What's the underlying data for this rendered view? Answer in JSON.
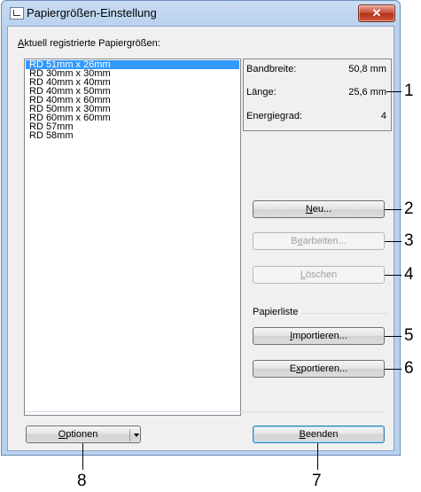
{
  "window": {
    "title": "Papiergrößen-Einstellung",
    "close_symbol": "✕"
  },
  "list": {
    "label_underlined": "A",
    "label_rest": "ktuell registrierte Papiergrößen:",
    "items": [
      "RD 51mm x 26mm",
      "RD 30mm x 30mm",
      "RD 40mm x 40mm",
      "RD 40mm x 50mm",
      "RD 40mm x 60mm",
      "RD 50mm x 30mm",
      "RD 60mm x 60mm",
      "RD 57mm",
      "RD 58mm"
    ],
    "selected_index": 0
  },
  "info": {
    "rows": [
      {
        "label": "Bandbreite:",
        "value": "50,8 mm"
      },
      {
        "label": "Länge:",
        "value": "25,6 mm"
      },
      {
        "label": "Energiegrad:",
        "value": "4"
      }
    ]
  },
  "buttons": {
    "neu": {
      "u": "N",
      "rest": "eu..."
    },
    "bearbeiten": {
      "pre": "B",
      "u": "e",
      "rest": "arbeiten..."
    },
    "loeschen": {
      "u": "L",
      "rest": "öschen"
    },
    "importieren": {
      "u": "I",
      "rest": "mportieren..."
    },
    "exportieren": {
      "pre": "E",
      "u": "x",
      "rest": "portieren..."
    },
    "optionen": {
      "u": "O",
      "rest": "ptionen"
    },
    "beenden": {
      "u": "B",
      "rest": "eenden"
    }
  },
  "papierliste_label": "Papierliste",
  "callouts": [
    "1",
    "2",
    "3",
    "4",
    "5",
    "6",
    "7",
    "8"
  ]
}
